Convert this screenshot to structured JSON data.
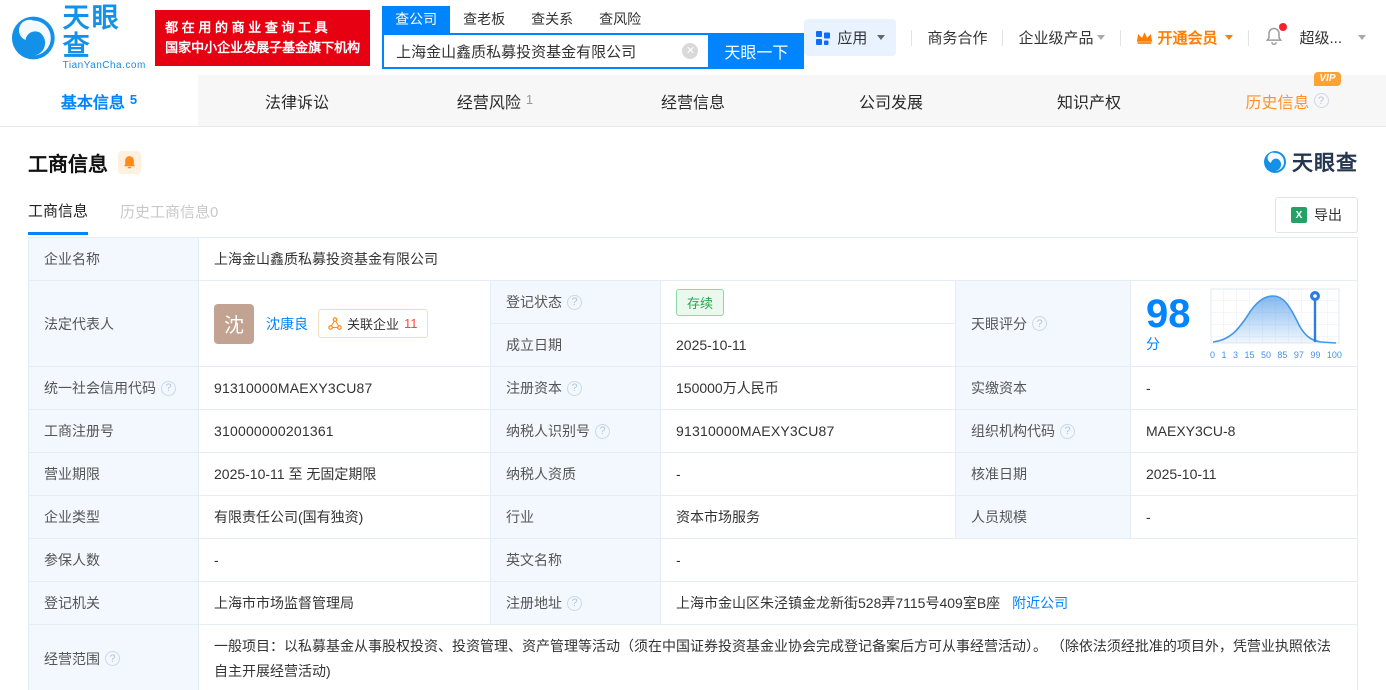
{
  "colors": {
    "primary": "#0084ff",
    "banner_red": "#e60012",
    "vip_orange": "#ff7e00",
    "status_green": "#27a448"
  },
  "header": {
    "logo_title": "天眼查",
    "logo_subtitle": "TianYanCha.com",
    "banner_line1": "都 在 用 的 商 业 查 询 工 具",
    "banner_line2": "国家中小企业发展子基金旗下机构",
    "search_tabs": {
      "company": "查公司",
      "boss": "查老板",
      "relation": "查关系",
      "risk": "查风险"
    },
    "search_value": "上海金山鑫质私募投资基金有限公司",
    "search_button": "天眼一下",
    "menu": {
      "apps": "应用",
      "cooperation": "商务合作",
      "enterprise": "企业级产品",
      "vip": "开通会员",
      "super": "超级..."
    }
  },
  "nav": {
    "tabs": [
      {
        "label": "基本信息",
        "count": "5"
      },
      {
        "label": "法律诉讼",
        "count": ""
      },
      {
        "label": "经营风险",
        "count": "1"
      },
      {
        "label": "经营信息",
        "count": ""
      },
      {
        "label": "公司发展",
        "count": ""
      },
      {
        "label": "知识产权",
        "count": ""
      },
      {
        "label": "历史信息",
        "count": "",
        "vip_badge": "VIP"
      }
    ]
  },
  "section": {
    "title": "工商信息",
    "watermark": "天眼查",
    "subtab_active": "工商信息",
    "subtab_history": "历史工商信息0",
    "export_label": "导出"
  },
  "info": {
    "company_name_label": "企业名称",
    "company_name": "上海金山鑫质私募投资基金有限公司",
    "legal_rep_label": "法定代表人",
    "legal_rep_avatar": "沈",
    "legal_rep_name": "沈康良",
    "related_label": "关联企业",
    "related_count": "11",
    "reg_status_label": "登记状态",
    "reg_status": "存续",
    "establish_label": "成立日期",
    "establish_date": "2025-10-11",
    "score_label": "天眼评分",
    "score": "98",
    "score_unit": "分",
    "score_ticks": [
      "0",
      "1",
      "3",
      "15",
      "50",
      "85",
      "97",
      "99",
      "100"
    ],
    "credit_code_label": "统一社会信用代码",
    "credit_code": "91310000MAEXY3CU87",
    "reg_capital_label": "注册资本",
    "reg_capital": "150000万人民币",
    "paid_capital_label": "实缴资本",
    "paid_capital": "-",
    "reg_number_label": "工商注册号",
    "reg_number": "310000000201361",
    "taxpayer_id_label": "纳税人识别号",
    "taxpayer_id": "91310000MAEXY3CU87",
    "org_code_label": "组织机构代码",
    "org_code": "MAEXY3CU-8",
    "business_term_label": "营业期限",
    "business_term": "2025-10-11 至 无固定期限",
    "taxpayer_quality_label": "纳税人资质",
    "taxpayer_quality": "-",
    "approval_date_label": "核准日期",
    "approval_date": "2025-10-11",
    "company_type_label": "企业类型",
    "company_type": "有限责任公司(国有独资)",
    "industry_label": "行业",
    "industry": "资本市场服务",
    "staff_size_label": "人员规模",
    "staff_size": "-",
    "insured_label": "参保人数",
    "insured": "-",
    "english_name_label": "英文名称",
    "english_name": "-",
    "reg_authority_label": "登记机关",
    "reg_authority": "上海市市场监督管理局",
    "address_label": "注册地址",
    "address": "上海市金山区朱泾镇金龙新街528弄7115号409室B座",
    "nearby_link": "附近公司",
    "business_scope_label": "经营范围",
    "business_scope": "一般项目：以私募基金从事股权投资、投资管理、资产管理等活动（须在中国证券投资基金业协会完成登记备案后方可从事经营活动）。 （除依法须经批准的项目外，凭营业执照依法自主开展经营活动)"
  }
}
